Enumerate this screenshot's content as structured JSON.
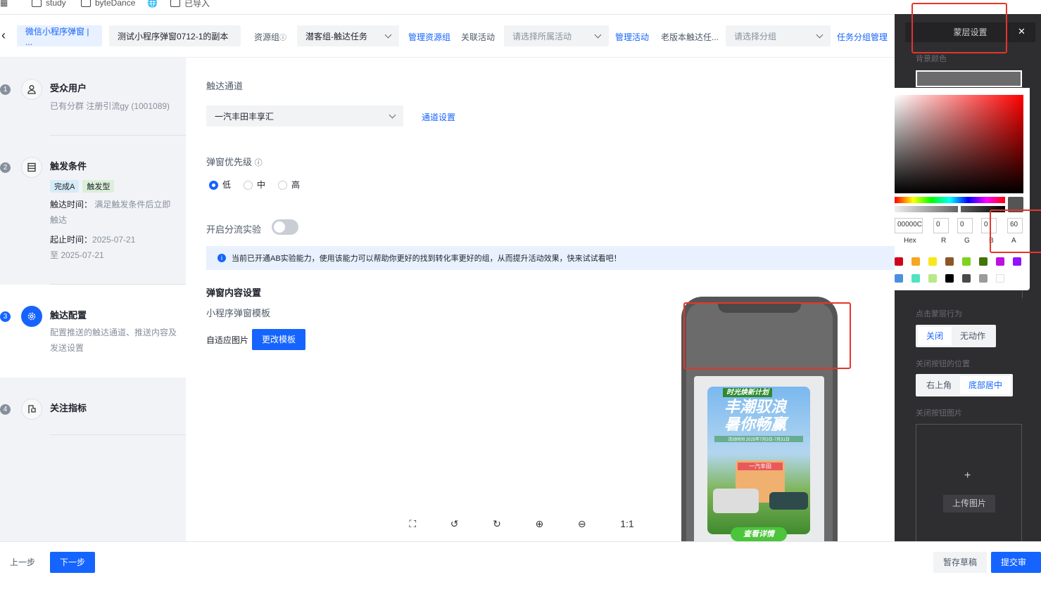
{
  "bookmarks": [
    "study",
    "byteDance",
    "已导入"
  ],
  "header": {
    "back": "‹",
    "tab_active": "微信小程序弹窗 | ...",
    "task_name": "测试小程序弹窗0712-1的副本",
    "resource_group_label": "资源组",
    "resource_group_value": "潜客组-触达任务",
    "manage_resource_group": "管理资源组",
    "related_activity_label": "关联活动",
    "activity_placeholder": "请选择所属活动",
    "manage_activity": "管理活动",
    "old_version": "老版本触达任...",
    "group_placeholder": "请选择分组",
    "group_manage": "任务分组管理"
  },
  "steps": [
    {
      "num": "1",
      "title": "受众用户",
      "text": "已有分群 注册引流gy (1001089)",
      "icon": "user-icon"
    },
    {
      "num": "2",
      "title": "触发条件",
      "tags": [
        "完成A",
        "触发型"
      ],
      "time_label": "触达时间：",
      "time_value": "满足触发条件后立即触达",
      "range_label": "起止时间：",
      "range_start": "2025-07-21",
      "range_end": "至 2025-07-21",
      "icon": "list-icon"
    },
    {
      "num": "3",
      "title": "触达配置",
      "text": "配置推送的触达通道、推送内容及发送设置",
      "icon": "gear-icon"
    },
    {
      "num": "4",
      "title": "关注指标",
      "icon": "flag-icon"
    }
  ],
  "main": {
    "channel_label": "触达通道",
    "channel_value": "一汽丰田丰享汇",
    "channel_settings": "通道设置",
    "priority_label": "弹窗优先级",
    "priority_options": [
      "低",
      "中",
      "高"
    ],
    "priority_selected": "低",
    "ab_label": "开启分流实验",
    "ab_enabled": false,
    "info": "当前已开通AB实验能力，使用该能力可以帮助你更好的找到转化率更好的组，从而提升活动效果，快来试试看吧！",
    "content_title": "弹窗内容设置",
    "template_label": "小程序弹窗模板",
    "adaptive_label": "自适应图片",
    "change_template": "更改模板"
  },
  "poster": {
    "badge": "时光焕新计划",
    "title1": "丰潮驭浪",
    "title2": "暑你畅赢",
    "date": "活动时间 2025年7月3日-7月31日",
    "brand": "一汽丰田",
    "cta": "查看详情"
  },
  "toolbar": {
    "fullscreen": "⛶",
    "rotate_left": "↺",
    "rotate_right": "↻",
    "zoom_in": "⊕",
    "zoom_out": "⊖",
    "actual": "1:1"
  },
  "panel": {
    "title": "蒙层设置",
    "close": "✕",
    "bg_color_label": "背景颜色",
    "click_label": "点击蒙层行为",
    "click_options": [
      "关闭",
      "无动作"
    ],
    "click_selected": "关闭",
    "close_pos_label": "关闭按钮的位置",
    "close_pos_options": [
      "右上角",
      "底部居中"
    ],
    "close_pos_selected": "底部居中",
    "close_img_label": "关闭按钮图片",
    "upload": "上传图片",
    "plus": "+"
  },
  "picker": {
    "hex": "00000C",
    "r": "0",
    "g": "0",
    "b": "0",
    "a": "60",
    "labels": [
      "Hex",
      "R",
      "G",
      "B",
      "A"
    ],
    "swatches": [
      "#d0021b",
      "#f5a623",
      "#f8e71c",
      "#8b572a",
      "#7ed321",
      "#417505",
      "#bd10e0",
      "#9013fe",
      "#4a90e2",
      "#50e3c2",
      "#b8e986",
      "#000000",
      "#4a4a4a",
      "#9b9b9b",
      "#ffffff"
    ]
  },
  "footer": {
    "prev": "上一步",
    "next": "下一步",
    "draft": "暂存草稿",
    "submit": "提交审批"
  },
  "colors": {
    "accent": "#1664ff",
    "panel": "#2e2e31",
    "highlight": "#e5352b"
  }
}
